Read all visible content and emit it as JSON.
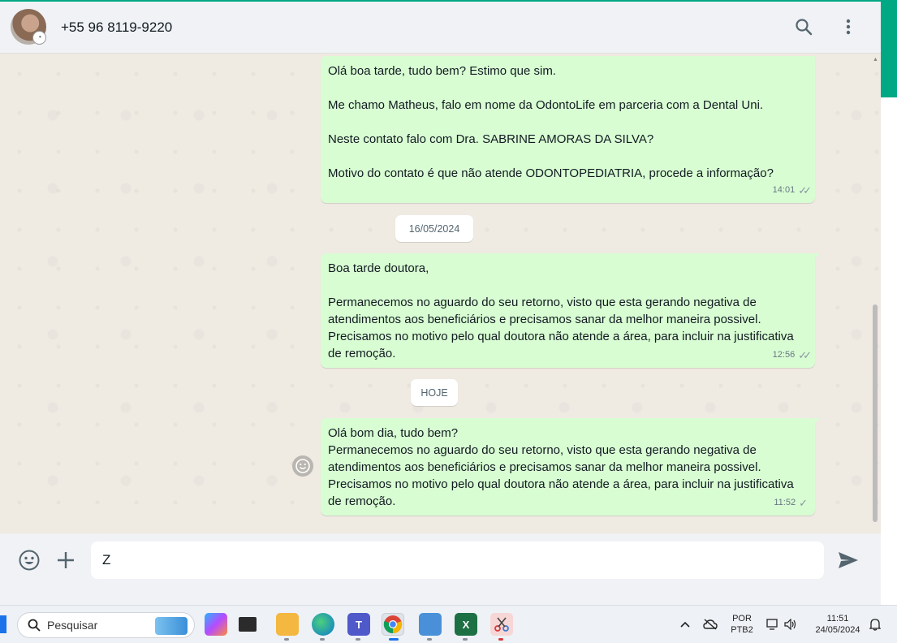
{
  "header": {
    "contact_name": "+55 96 8119-9220"
  },
  "messages": [
    {
      "text": "Olá boa tarde, tudo bem? Estimo que sim.\n\nMe chamo Matheus, falo em nome da OdontoLife em parceria com a Dental Uni.\n\nNeste contato falo com Dra. SABRINE AMORAS DA SILVA?\n\nMotivo do contato é que não atende ODONTOPEDIATRIA, procede a informação?",
      "time": "14:01",
      "status": "double-check"
    },
    {
      "text": "Boa tarde doutora,\n\nPermanecemos no aguardo do seu retorno, visto que esta gerando negativa de atendimentos aos beneficiários e precisamos sanar da melhor maneira possivel.\nPrecisamos no motivo pelo qual doutora não atende a área, para incluir na justificativa de remoção.",
      "time": "12:56",
      "status": "double-check"
    },
    {
      "text": "Olá bom dia, tudo bem?\nPermanecemos no aguardo do seu retorno, visto que esta gerando negativa de atendimentos aos beneficiários e precisamos sanar da melhor maneira possivel.\nPrecisamos no motivo pelo qual doutora não atende a área, para incluir na justificativa de remoção.",
      "time": "11:52",
      "status": "single-check"
    }
  ],
  "date_chips": [
    "16/05/2024",
    "HOJE"
  ],
  "composer": {
    "value": "Z"
  },
  "taskbar": {
    "search_label": "Pesquisar",
    "lang_top": "POR",
    "lang_bottom": "PTB2",
    "time": "11:51",
    "date": "24/05/2024",
    "apps": [
      "copilot-icon",
      "task-view-icon",
      "file-explorer-icon",
      "edge-icon",
      "teams-icon",
      "chrome-icon",
      "notepad-icon",
      "excel-icon",
      "snipping-tool-icon"
    ]
  },
  "colors": {
    "accent": "#00a884",
    "outgoing_bubble": "#d9fdd3",
    "chat_bg": "#efeae2"
  }
}
